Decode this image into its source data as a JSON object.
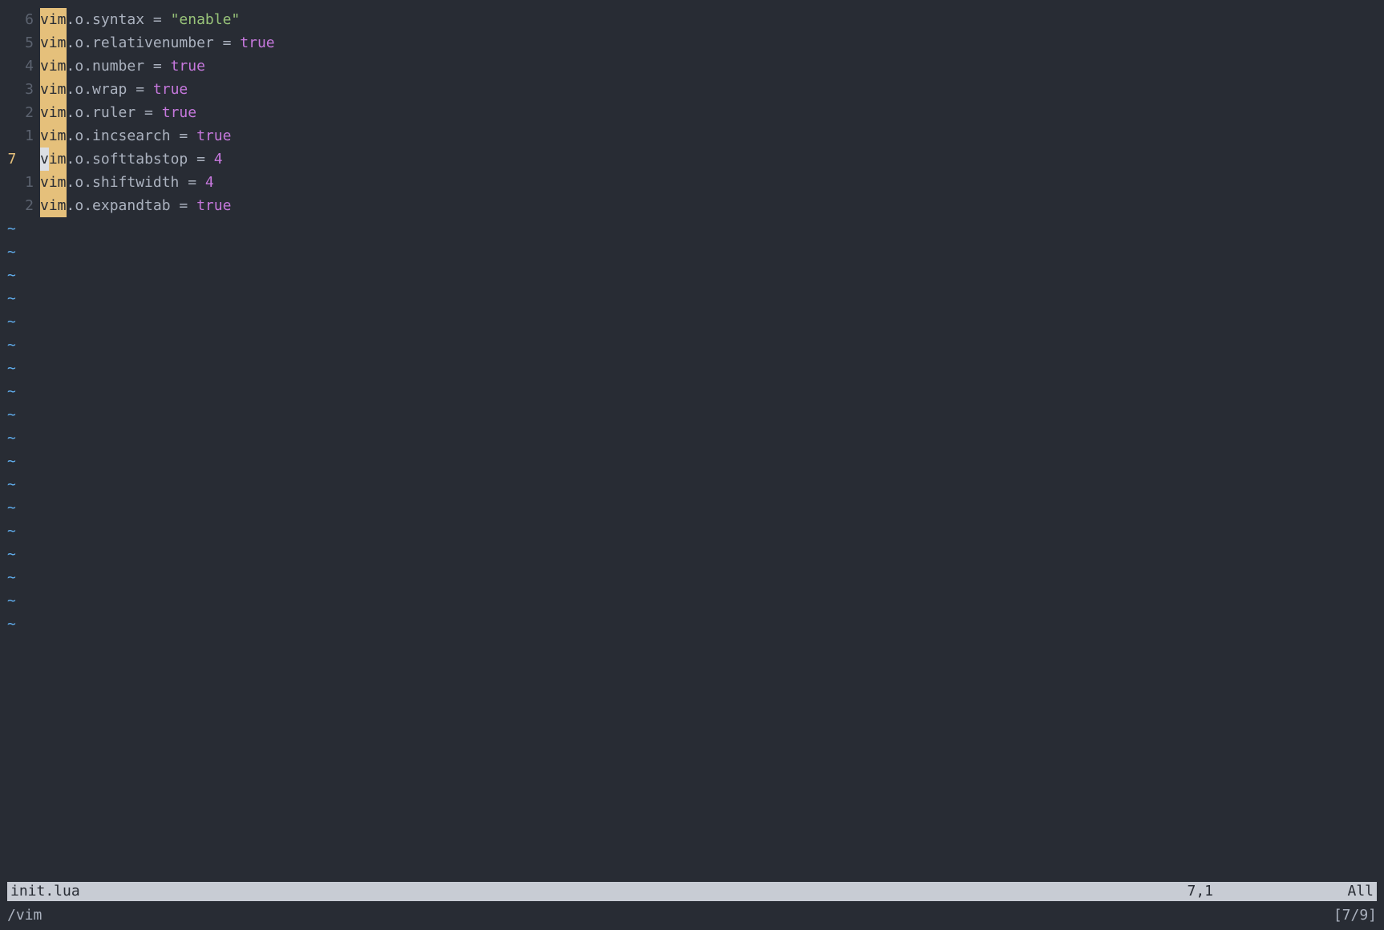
{
  "current_line_index": 6,
  "search_term": "vim",
  "lines": [
    {
      "num": "6",
      "current": false,
      "vim_hl": "search",
      "field": ".o.syntax",
      "op": " = ",
      "value": "\"enable\"",
      "value_type": "string"
    },
    {
      "num": "5",
      "current": false,
      "vim_hl": "search",
      "field": ".o.relativenumber",
      "op": " = ",
      "value": "true",
      "value_type": "const"
    },
    {
      "num": "4",
      "current": false,
      "vim_hl": "search",
      "field": ".o.number",
      "op": " = ",
      "value": "true",
      "value_type": "const"
    },
    {
      "num": "3",
      "current": false,
      "vim_hl": "search",
      "field": ".o.wrap",
      "op": " = ",
      "value": "true",
      "value_type": "const"
    },
    {
      "num": "2",
      "current": false,
      "vim_hl": "search",
      "field": ".o.ruler",
      "op": " = ",
      "value": "true",
      "value_type": "const"
    },
    {
      "num": "1",
      "current": false,
      "vim_hl": "search",
      "field": ".o.incsearch",
      "op": " = ",
      "value": "true",
      "value_type": "const"
    },
    {
      "num": "7  ",
      "current": true,
      "vim_hl": "cursor",
      "field": ".o.softtabstop",
      "op": " = ",
      "value": "4",
      "value_type": "num"
    },
    {
      "num": "1",
      "current": false,
      "vim_hl": "search",
      "field": ".o.shiftwidth",
      "op": " = ",
      "value": "4",
      "value_type": "num"
    },
    {
      "num": "2",
      "current": false,
      "vim_hl": "search",
      "field": ".o.expandtab",
      "op": " = ",
      "value": "true",
      "value_type": "const"
    }
  ],
  "tilde_count": 18,
  "tilde_char": "~",
  "statusline": {
    "filename": "init.lua",
    "ruler": "7,1",
    "scroll": "All"
  },
  "cmdline": {
    "search": "/vim",
    "count": "[7/9]"
  }
}
